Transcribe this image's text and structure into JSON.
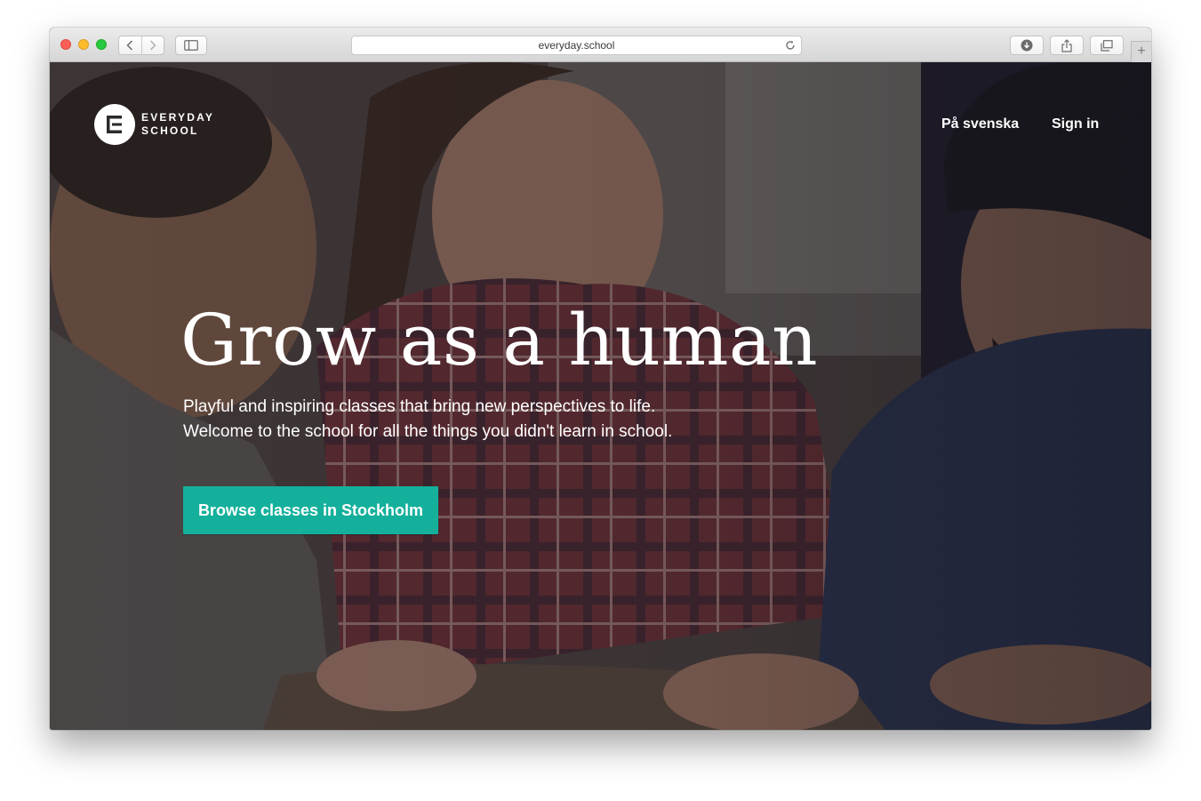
{
  "browser": {
    "url": "everyday.school",
    "icons": {
      "back": "chevron-left-icon",
      "forward": "chevron-right-icon",
      "sidebar": "sidebar-icon",
      "reload": "reload-icon",
      "downloads": "download-icon",
      "share": "share-icon",
      "tabs": "tabs-icon",
      "new_tab": "plus-icon"
    }
  },
  "site": {
    "logo": {
      "line1": "EVERYDAY",
      "line2": "SCHOOL"
    },
    "nav": {
      "swedish": "På svenska",
      "signin": "Sign in"
    },
    "hero": {
      "headline": "Grow as a human",
      "subtitle_line1": "Playful and inspiring classes that bring new perspectives to life.",
      "subtitle_line2": "Welcome to the school for all the things you didn't learn in school.",
      "cta": "Browse classes in Stockholm"
    }
  },
  "colors": {
    "accent": "#14b09b",
    "traffic_red": "#fc5f57",
    "traffic_yellow": "#fdbc2e",
    "traffic_green": "#28c840"
  }
}
